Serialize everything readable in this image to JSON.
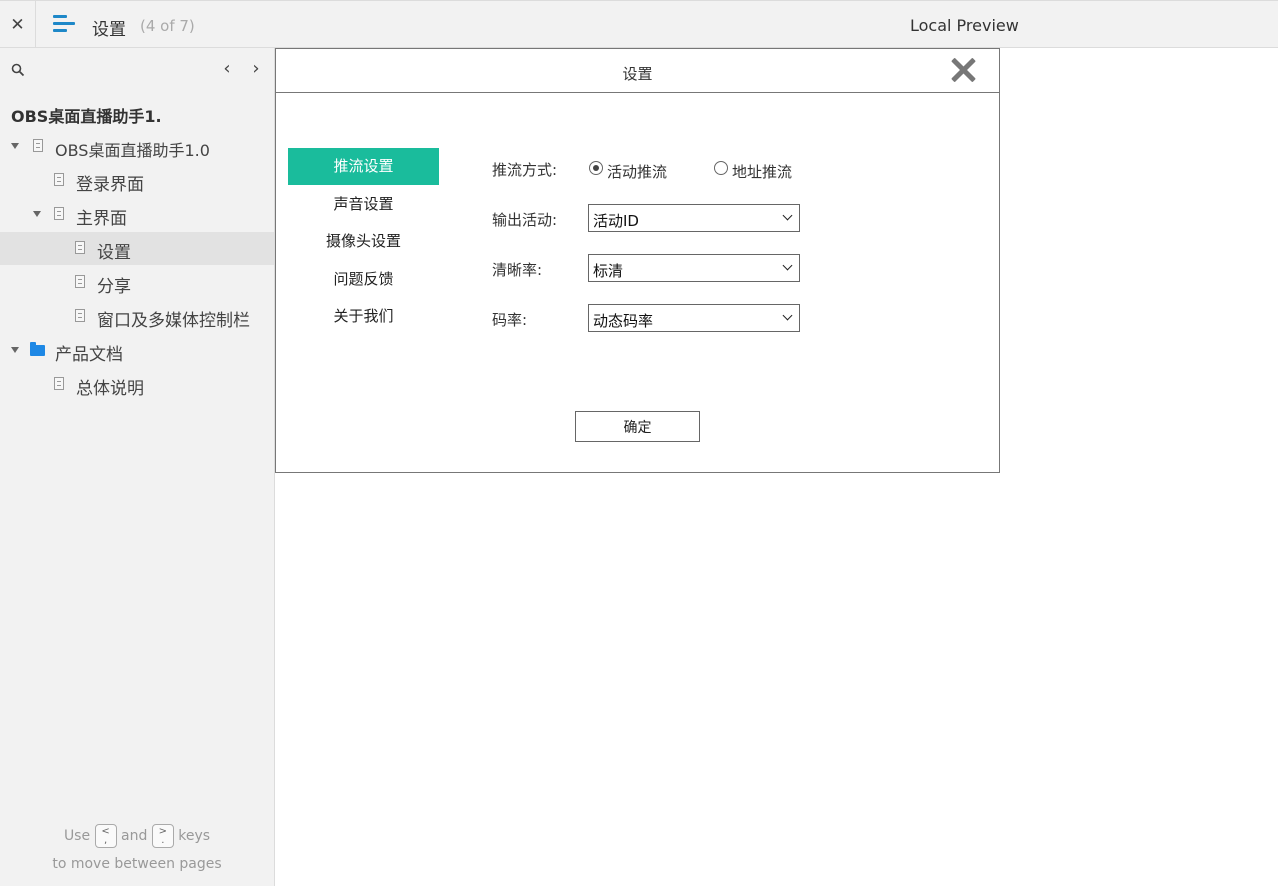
{
  "topbar": {
    "close_glyph": "✕",
    "title": "设置",
    "count": "(4 of 7)",
    "right_label": "Local Preview"
  },
  "sidebar": {
    "prev_glyph": "‹",
    "next_glyph": "›",
    "root_title": "OBS桌面直播助手1.",
    "items": [
      {
        "label": "OBS桌面直播助手1.0"
      },
      {
        "label": "登录界面"
      },
      {
        "label": "主界面"
      },
      {
        "label": "设置"
      },
      {
        "label": "分享"
      },
      {
        "label": "窗口及多媒体控制栏"
      },
      {
        "label": "产品文档"
      },
      {
        "label": "总体说明"
      }
    ],
    "hint": {
      "use": "Use",
      "key_prev": "<",
      "key_prev_sub": ",",
      "and": "and",
      "key_next": ">",
      "key_next_sub": ".",
      "keys": "keys",
      "line2": "to move between pages"
    }
  },
  "dialog": {
    "title": "设置",
    "menu": [
      {
        "label": "推流设置"
      },
      {
        "label": "声音设置"
      },
      {
        "label": "摄像头设置"
      },
      {
        "label": "问题反馈"
      },
      {
        "label": "关于我们"
      }
    ],
    "push_mode": {
      "label": "推流方式:",
      "options": [
        {
          "label": "活动推流",
          "checked": true
        },
        {
          "label": "地址推流",
          "checked": false
        }
      ]
    },
    "output_activity": {
      "label": "输出活动:",
      "value": "活动ID"
    },
    "clarity": {
      "label": "清晰率:",
      "value": "标清"
    },
    "bitrate": {
      "label": "码率:",
      "value": "动态码率"
    },
    "ok_label": "确定"
  },
  "colors": {
    "accent": "#1abc9c",
    "menu_icon": "#1e88c8",
    "folder": "#1e88e5"
  }
}
